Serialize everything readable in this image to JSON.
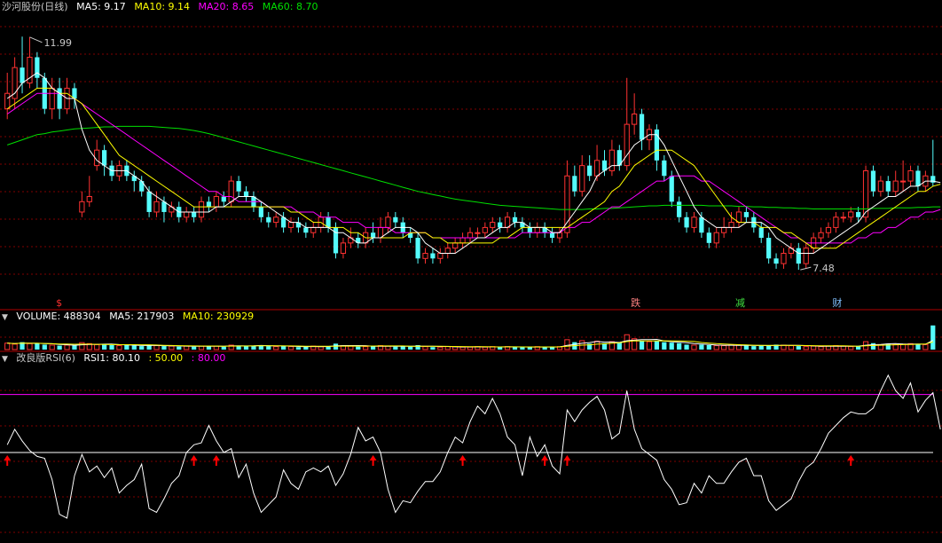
{
  "header": {
    "title": "沙河股份(日线)",
    "ma5": "MA5: 9.17",
    "ma10": "MA10: 9.14",
    "ma20": "MA20: 8.65",
    "ma60": "MA60: 8.70"
  },
  "volume_header": {
    "label": "VOLUME: 488304",
    "ma5": "MA5: 217903",
    "ma10": "MA10: 230929"
  },
  "rsi_header": {
    "label": "改良版RSI(6)",
    "rsi1": "RSI1: 80.10",
    "v50": ": 50.00",
    "v80": ": 80.00"
  },
  "annotations": {
    "high": "11.99",
    "low": "7.48",
    "markers": [
      "$",
      "跌",
      "减",
      "财"
    ]
  },
  "colors": {
    "up": "#ff3232",
    "down": "#54fcfc",
    "ma5": "#ffffff",
    "ma10": "#ffff00",
    "ma20": "#ff00ff",
    "ma60": "#00e000",
    "grid": "#800000",
    "rsi": "#ffffff",
    "line80": "#ff00ff",
    "line50": "#ffffff",
    "arrow": "#ff0000"
  },
  "chart_data": {
    "type": "candlestick",
    "price_ylim": [
      7.0,
      12.4
    ],
    "candles": [
      [
        10.6,
        10.9,
        11.3,
        10.4
      ],
      [
        10.8,
        11.4,
        11.6,
        10.6
      ],
      [
        11.4,
        11.1,
        12.0,
        10.9
      ],
      [
        11.1,
        11.6,
        11.99,
        11.0
      ],
      [
        11.6,
        11.2,
        11.7,
        11.0
      ],
      [
        11.2,
        10.6,
        11.3,
        10.5
      ],
      [
        10.6,
        11.0,
        11.2,
        10.4
      ],
      [
        11.0,
        10.6,
        11.2,
        10.4
      ],
      [
        10.6,
        11.0,
        11.2,
        10.5
      ],
      [
        11.0,
        10.8,
        11.1,
        10.6
      ],
      [
        8.6,
        8.8,
        9.0,
        8.5
      ],
      [
        8.8,
        8.9,
        9.3,
        8.7
      ],
      [
        9.5,
        9.8,
        10.0,
        9.4
      ],
      [
        9.8,
        9.5,
        9.9,
        9.3
      ],
      [
        9.5,
        9.3,
        9.6,
        9.2
      ],
      [
        9.3,
        9.5,
        9.6,
        9.2
      ],
      [
        9.5,
        9.3,
        9.6,
        9.2
      ],
      [
        9.3,
        9.2,
        9.4,
        9.0
      ],
      [
        9.2,
        9.0,
        9.3,
        8.9
      ],
      [
        9.0,
        8.6,
        9.1,
        8.5
      ],
      [
        8.6,
        8.8,
        9.0,
        8.5
      ],
      [
        8.8,
        8.6,
        8.9,
        8.4
      ],
      [
        8.6,
        8.7,
        8.8,
        8.5
      ],
      [
        8.7,
        8.5,
        8.8,
        8.4
      ],
      [
        8.5,
        8.6,
        8.7,
        8.4
      ],
      [
        8.6,
        8.5,
        8.7,
        8.4
      ],
      [
        8.5,
        8.8,
        8.9,
        8.4
      ],
      [
        8.8,
        8.7,
        8.9,
        8.6
      ],
      [
        8.7,
        8.9,
        9.0,
        8.6
      ],
      [
        8.9,
        8.8,
        9.0,
        8.7
      ],
      [
        8.8,
        9.2,
        9.3,
        8.7
      ],
      [
        9.2,
        9.0,
        9.3,
        8.9
      ],
      [
        9.0,
        8.9,
        9.1,
        8.8
      ],
      [
        8.9,
        8.7,
        9.0,
        8.6
      ],
      [
        8.7,
        8.5,
        8.8,
        8.4
      ],
      [
        8.5,
        8.4,
        8.6,
        8.3
      ],
      [
        8.4,
        8.5,
        8.6,
        8.3
      ],
      [
        8.5,
        8.3,
        8.6,
        8.2
      ],
      [
        8.3,
        8.4,
        8.5,
        8.2
      ],
      [
        8.4,
        8.3,
        8.5,
        8.2
      ],
      [
        8.3,
        8.2,
        8.4,
        8.1
      ],
      [
        8.2,
        8.3,
        8.4,
        8.1
      ],
      [
        8.3,
        8.5,
        8.6,
        8.2
      ],
      [
        8.5,
        8.3,
        8.6,
        8.2
      ],
      [
        8.3,
        7.8,
        8.4,
        7.7
      ],
      [
        7.8,
        8.0,
        8.1,
        7.7
      ],
      [
        8.0,
        8.1,
        8.3,
        7.9
      ],
      [
        8.1,
        8.0,
        8.2,
        7.9
      ],
      [
        8.0,
        8.2,
        8.3,
        7.9
      ],
      [
        8.2,
        8.1,
        8.4,
        8.0
      ],
      [
        8.1,
        8.3,
        8.5,
        8.0
      ],
      [
        8.3,
        8.5,
        8.6,
        8.2
      ],
      [
        8.5,
        8.4,
        8.6,
        8.3
      ],
      [
        8.4,
        8.2,
        8.5,
        8.1
      ],
      [
        8.2,
        8.1,
        8.3,
        8.0
      ],
      [
        8.1,
        7.7,
        8.2,
        7.6
      ],
      [
        7.7,
        7.8,
        7.9,
        7.6
      ],
      [
        7.8,
        7.7,
        7.9,
        7.6
      ],
      [
        7.7,
        7.8,
        7.9,
        7.6
      ],
      [
        7.8,
        7.9,
        8.0,
        7.7
      ],
      [
        7.9,
        8.0,
        8.1,
        7.8
      ],
      [
        8.0,
        8.1,
        8.2,
        7.9
      ],
      [
        8.1,
        8.2,
        8.3,
        8.0
      ],
      [
        8.2,
        8.2,
        8.3,
        8.1
      ],
      [
        8.2,
        8.3,
        8.4,
        8.1
      ],
      [
        8.3,
        8.4,
        8.5,
        8.2
      ],
      [
        8.4,
        8.3,
        8.5,
        8.2
      ],
      [
        8.3,
        8.5,
        8.6,
        8.2
      ],
      [
        8.5,
        8.4,
        8.6,
        8.3
      ],
      [
        8.4,
        8.3,
        8.5,
        8.2
      ],
      [
        8.3,
        8.2,
        8.4,
        8.1
      ],
      [
        8.2,
        8.3,
        8.4,
        8.1
      ],
      [
        8.3,
        8.2,
        8.4,
        8.1
      ],
      [
        8.2,
        8.1,
        8.3,
        8.0
      ],
      [
        8.1,
        8.2,
        8.3,
        8.0
      ],
      [
        8.2,
        9.3,
        9.6,
        8.1
      ],
      [
        9.3,
        9.0,
        9.5,
        8.9
      ],
      [
        9.0,
        9.5,
        9.7,
        8.9
      ],
      [
        9.5,
        9.3,
        9.7,
        9.2
      ],
      [
        9.3,
        9.6,
        9.9,
        9.2
      ],
      [
        9.6,
        9.4,
        9.8,
        9.3
      ],
      [
        9.4,
        9.8,
        10.0,
        9.3
      ],
      [
        9.8,
        9.5,
        9.9,
        9.4
      ],
      [
        9.5,
        10.3,
        11.2,
        9.4
      ],
      [
        10.3,
        10.5,
        10.9,
        10.1
      ],
      [
        10.5,
        10.0,
        10.6,
        9.8
      ],
      [
        10.0,
        10.2,
        10.3,
        9.8
      ],
      [
        10.2,
        9.6,
        10.3,
        9.4
      ],
      [
        9.6,
        9.3,
        9.7,
        9.2
      ],
      [
        9.3,
        8.8,
        9.4,
        8.7
      ],
      [
        8.8,
        8.5,
        8.9,
        8.4
      ],
      [
        8.5,
        8.3,
        8.6,
        8.2
      ],
      [
        8.3,
        8.5,
        8.6,
        8.2
      ],
      [
        8.5,
        8.2,
        8.6,
        8.1
      ],
      [
        8.2,
        8.0,
        8.3,
        7.9
      ],
      [
        8.0,
        8.2,
        8.3,
        7.9
      ],
      [
        8.2,
        8.3,
        8.5,
        8.1
      ],
      [
        8.3,
        8.4,
        8.6,
        8.2
      ],
      [
        8.4,
        8.6,
        8.7,
        8.3
      ],
      [
        8.6,
        8.5,
        8.7,
        8.4
      ],
      [
        8.5,
        8.3,
        8.6,
        8.2
      ],
      [
        8.3,
        8.1,
        8.4,
        8.0
      ],
      [
        8.1,
        7.7,
        8.2,
        7.6
      ],
      [
        7.7,
        7.6,
        7.8,
        7.5
      ],
      [
        7.6,
        7.8,
        7.9,
        7.5
      ],
      [
        7.8,
        7.9,
        8.0,
        7.7
      ],
      [
        7.9,
        7.6,
        8.0,
        7.48
      ],
      [
        7.6,
        7.9,
        8.0,
        7.5
      ],
      [
        7.9,
        8.1,
        8.2,
        7.8
      ],
      [
        8.1,
        8.2,
        8.3,
        8.0
      ],
      [
        8.2,
        8.3,
        8.4,
        8.1
      ],
      [
        8.3,
        8.5,
        8.6,
        8.2
      ],
      [
        8.5,
        8.5,
        8.6,
        8.4
      ],
      [
        8.5,
        8.6,
        8.7,
        8.4
      ],
      [
        8.6,
        8.5,
        8.7,
        8.4
      ],
      [
        8.5,
        9.4,
        9.5,
        8.4
      ],
      [
        9.4,
        9.0,
        9.5,
        8.9
      ],
      [
        9.0,
        9.2,
        9.3,
        8.9
      ],
      [
        9.2,
        9.0,
        9.3,
        8.9
      ],
      [
        9.0,
        9.2,
        9.4,
        8.9
      ],
      [
        9.2,
        9.2,
        9.6,
        9.0
      ],
      [
        9.2,
        9.4,
        9.5,
        9.1
      ],
      [
        9.4,
        9.1,
        9.5,
        9.0
      ],
      [
        9.1,
        9.3,
        9.4,
        9.0
      ],
      [
        9.3,
        9.17,
        10.0,
        9.1
      ]
    ],
    "ma5": [
      10.8,
      10.9,
      11.1,
      11.2,
      11.3,
      11.2,
      11.0,
      10.9,
      10.8,
      10.8,
      10.2,
      9.8,
      9.6,
      9.5,
      9.4,
      9.4,
      9.4,
      9.3,
      9.2,
      9.0,
      8.9,
      8.8,
      8.7,
      8.6,
      8.6,
      8.6,
      8.6,
      8.6,
      8.7,
      8.7,
      8.8,
      8.9,
      8.9,
      8.9,
      8.8,
      8.7,
      8.6,
      8.5,
      8.4,
      8.4,
      8.3,
      8.3,
      8.3,
      8.3,
      8.2,
      8.2,
      8.1,
      8.0,
      8.0,
      8.1,
      8.1,
      8.2,
      8.3,
      8.3,
      8.3,
      8.2,
      8.0,
      7.9,
      7.8,
      7.8,
      7.8,
      7.9,
      8.0,
      8.1,
      8.1,
      8.2,
      8.3,
      8.3,
      8.4,
      8.4,
      8.3,
      8.3,
      8.3,
      8.2,
      8.2,
      8.4,
      8.6,
      8.8,
      9.0,
      9.3,
      9.4,
      9.5,
      9.5,
      9.7,
      9.9,
      10.0,
      10.1,
      10.1,
      9.9,
      9.6,
      9.3,
      9.0,
      8.7,
      8.5,
      8.4,
      8.3,
      8.3,
      8.3,
      8.3,
      8.4,
      8.4,
      8.4,
      8.3,
      8.1,
      8.0,
      7.9,
      7.8,
      7.8,
      7.8,
      7.9,
      8.0,
      8.1,
      8.2,
      8.3,
      8.4,
      8.6,
      8.7,
      8.8,
      8.9,
      8.9,
      9.0,
      9.1,
      9.1,
      9.2,
      9.2,
      9.17
    ],
    "ma10": [
      10.6,
      10.7,
      10.8,
      10.9,
      11.0,
      11.0,
      11.0,
      10.9,
      10.9,
      10.8,
      10.7,
      10.5,
      10.3,
      10.1,
      9.9,
      9.7,
      9.6,
      9.5,
      9.4,
      9.3,
      9.2,
      9.1,
      9.0,
      8.9,
      8.8,
      8.7,
      8.7,
      8.7,
      8.7,
      8.7,
      8.7,
      8.7,
      8.7,
      8.7,
      8.7,
      8.7,
      8.7,
      8.7,
      8.6,
      8.6,
      8.5,
      8.4,
      8.4,
      8.3,
      8.3,
      8.3,
      8.2,
      8.2,
      8.1,
      8.1,
      8.1,
      8.1,
      8.1,
      8.1,
      8.2,
      8.2,
      8.2,
      8.1,
      8.1,
      8.0,
      8.0,
      8.0,
      8.0,
      8.0,
      8.0,
      8.0,
      8.1,
      8.1,
      8.2,
      8.3,
      8.3,
      8.3,
      8.3,
      8.3,
      8.3,
      8.3,
      8.4,
      8.5,
      8.6,
      8.7,
      8.8,
      9.0,
      9.1,
      9.3,
      9.5,
      9.6,
      9.7,
      9.8,
      9.8,
      9.8,
      9.7,
      9.6,
      9.5,
      9.3,
      9.1,
      8.9,
      8.7,
      8.5,
      8.4,
      8.4,
      8.4,
      8.3,
      8.3,
      8.3,
      8.2,
      8.2,
      8.1,
      8.0,
      7.9,
      7.9,
      7.9,
      7.9,
      8.0,
      8.1,
      8.2,
      8.3,
      8.4,
      8.5,
      8.6,
      8.7,
      8.8,
      8.9,
      9.0,
      9.0,
      9.1,
      9.14
    ],
    "ma20": [
      10.5,
      10.6,
      10.7,
      10.8,
      10.9,
      10.9,
      10.9,
      10.9,
      10.8,
      10.8,
      10.7,
      10.6,
      10.5,
      10.4,
      10.3,
      10.2,
      10.1,
      10.0,
      9.9,
      9.8,
      9.7,
      9.6,
      9.5,
      9.4,
      9.3,
      9.2,
      9.1,
      9.0,
      9.0,
      8.9,
      8.9,
      8.8,
      8.8,
      8.8,
      8.8,
      8.7,
      8.7,
      8.7,
      8.7,
      8.6,
      8.6,
      8.6,
      8.5,
      8.5,
      8.5,
      8.4,
      8.4,
      8.4,
      8.3,
      8.3,
      8.3,
      8.3,
      8.2,
      8.2,
      8.2,
      8.2,
      8.2,
      8.1,
      8.1,
      8.1,
      8.1,
      8.1,
      8.1,
      8.1,
      8.1,
      8.1,
      8.1,
      8.1,
      8.1,
      8.2,
      8.2,
      8.2,
      8.2,
      8.2,
      8.2,
      8.3,
      8.3,
      8.4,
      8.4,
      8.5,
      8.6,
      8.7,
      8.7,
      8.8,
      8.9,
      9.0,
      9.1,
      9.2,
      9.2,
      9.3,
      9.3,
      9.3,
      9.3,
      9.2,
      9.2,
      9.1,
      9.0,
      8.9,
      8.8,
      8.7,
      8.6,
      8.5,
      8.4,
      8.3,
      8.2,
      8.1,
      8.1,
      8.0,
      8.0,
      8.0,
      8.0,
      8.0,
      8.0,
      8.0,
      8.1,
      8.1,
      8.2,
      8.2,
      8.3,
      8.3,
      8.4,
      8.5,
      8.5,
      8.6,
      8.6,
      8.65
    ],
    "ma60": [
      9.9,
      9.95,
      10.0,
      10.05,
      10.1,
      10.12,
      10.15,
      10.17,
      10.19,
      10.21,
      10.22,
      10.23,
      10.24,
      10.25,
      10.25,
      10.26,
      10.26,
      10.26,
      10.26,
      10.26,
      10.25,
      10.24,
      10.23,
      10.22,
      10.2,
      10.18,
      10.15,
      10.12,
      10.08,
      10.04,
      10.0,
      9.96,
      9.92,
      9.88,
      9.84,
      9.8,
      9.76,
      9.72,
      9.68,
      9.64,
      9.6,
      9.56,
      9.52,
      9.48,
      9.44,
      9.4,
      9.36,
      9.32,
      9.28,
      9.24,
      9.2,
      9.16,
      9.12,
      9.08,
      9.04,
      9.0,
      8.97,
      8.94,
      8.91,
      8.88,
      8.85,
      8.83,
      8.81,
      8.79,
      8.77,
      8.75,
      8.73,
      8.72,
      8.71,
      8.7,
      8.69,
      8.68,
      8.67,
      8.66,
      8.65,
      8.65,
      8.65,
      8.65,
      8.66,
      8.66,
      8.67,
      8.67,
      8.68,
      8.69,
      8.7,
      8.71,
      8.72,
      8.72,
      8.73,
      8.73,
      8.73,
      8.73,
      8.73,
      8.73,
      8.72,
      8.72,
      8.72,
      8.72,
      8.71,
      8.71,
      8.7,
      8.7,
      8.69,
      8.69,
      8.68,
      8.68,
      8.67,
      8.67,
      8.66,
      8.66,
      8.66,
      8.66,
      8.66,
      8.66,
      8.66,
      8.66,
      8.67,
      8.67,
      8.67,
      8.68,
      8.68,
      8.68,
      8.69,
      8.69,
      8.7,
      8.7
    ],
    "volume": [
      1.3,
      1.1,
      1.5,
      1.2,
      1.3,
      1.0,
      0.9,
      0.8,
      0.9,
      0.8,
      1.4,
      1.2,
      1.0,
      1.1,
      0.9,
      0.8,
      0.9,
      0.8,
      0.7,
      0.9,
      0.8,
      0.7,
      0.7,
      0.6,
      0.7,
      0.6,
      0.7,
      0.8,
      0.7,
      0.6,
      0.9,
      0.8,
      0.7,
      0.8,
      0.9,
      0.7,
      0.6,
      0.7,
      0.6,
      0.5,
      0.6,
      0.7,
      0.6,
      0.7,
      1.2,
      0.8,
      0.7,
      0.6,
      0.6,
      0.7,
      0.8,
      0.7,
      0.6,
      0.7,
      0.6,
      0.9,
      0.6,
      0.5,
      0.5,
      0.6,
      0.6,
      0.5,
      0.5,
      0.6,
      0.5,
      0.6,
      0.5,
      0.6,
      0.5,
      0.5,
      0.5,
      0.6,
      0.5,
      0.5,
      0.6,
      2.0,
      1.5,
      1.8,
      1.2,
      1.7,
      1.3,
      1.6,
      1.4,
      3.0,
      2.2,
      1.8,
      1.6,
      1.7,
      1.5,
      1.4,
      1.3,
      1.0,
      0.9,
      1.0,
      0.9,
      0.8,
      0.8,
      0.9,
      0.9,
      0.8,
      0.7,
      0.8,
      0.8,
      1.0,
      0.9,
      0.8,
      0.7,
      0.6,
      0.7,
      0.6,
      0.7,
      0.8,
      0.7,
      0.6,
      0.7,
      1.6,
      1.3,
      1.0,
      1.2,
      1.0,
      1.1,
      1.2,
      1.1,
      1.0,
      4.88
    ],
    "volume_ylim": [
      0,
      5.2
    ],
    "rsi": [
      54,
      62,
      56,
      51,
      48,
      47,
      36,
      18,
      16,
      38,
      49,
      40,
      43,
      37,
      42,
      29,
      33,
      36,
      44,
      21,
      19,
      26,
      34,
      38,
      50,
      54,
      55,
      64,
      56,
      50,
      52,
      37,
      44,
      29,
      19,
      23,
      27,
      41,
      34,
      31,
      40,
      42,
      40,
      43,
      33,
      39,
      49,
      63,
      56,
      58,
      50,
      31,
      19,
      25,
      24,
      30,
      35,
      35,
      40,
      50,
      58,
      55,
      66,
      74,
      70,
      78,
      70,
      58,
      54,
      38,
      58,
      48,
      54,
      43,
      39,
      72,
      66,
      72,
      76,
      79,
      72,
      57,
      60,
      82,
      62,
      52,
      49,
      46,
      36,
      31,
      23,
      24,
      34,
      29,
      38,
      34,
      34,
      40,
      45,
      47,
      38,
      38,
      25,
      20,
      23,
      26,
      35,
      42,
      45,
      52,
      60,
      64,
      68,
      71,
      70,
      70,
      73,
      82,
      90,
      82,
      78,
      86,
      71,
      77,
      81,
      62
    ],
    "rsi_ylim": [
      5,
      95
    ],
    "rsi_levels": [
      50,
      80
    ],
    "arrows": [
      0,
      25,
      28,
      49,
      61,
      72,
      75,
      113
    ],
    "high_index": 3,
    "low_index": 106,
    "marker_positions": [
      7,
      84,
      98,
      111
    ]
  }
}
